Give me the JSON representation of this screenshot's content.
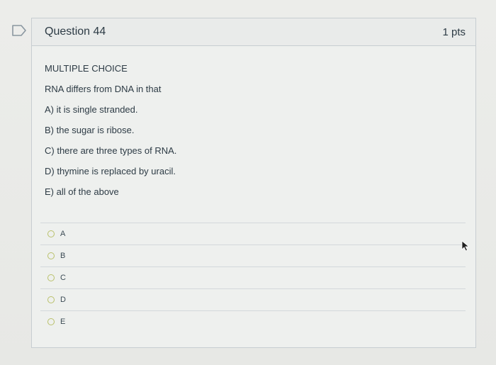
{
  "question": {
    "title": "Question 44",
    "points": "1 pts",
    "type_label": "MULTIPLE CHOICE",
    "prompt": "RNA differs from DNA in that",
    "statements": [
      "A) it is single stranded.",
      "B) the sugar is ribose.",
      "C) there are three types of RNA.",
      "D) thymine is replaced by uracil.",
      "E) all of the above"
    ]
  },
  "answers": [
    {
      "label": "A"
    },
    {
      "label": "B"
    },
    {
      "label": "C"
    },
    {
      "label": "D"
    },
    {
      "label": "E"
    }
  ],
  "icons": {
    "flag": "flag-question-icon",
    "cursor": "mouse-pointer-icon"
  },
  "colors": {
    "background": "#e6e7e4",
    "text": "#2d3b45",
    "border": "#c7cdd1",
    "radio_border": "#b9c06a"
  }
}
